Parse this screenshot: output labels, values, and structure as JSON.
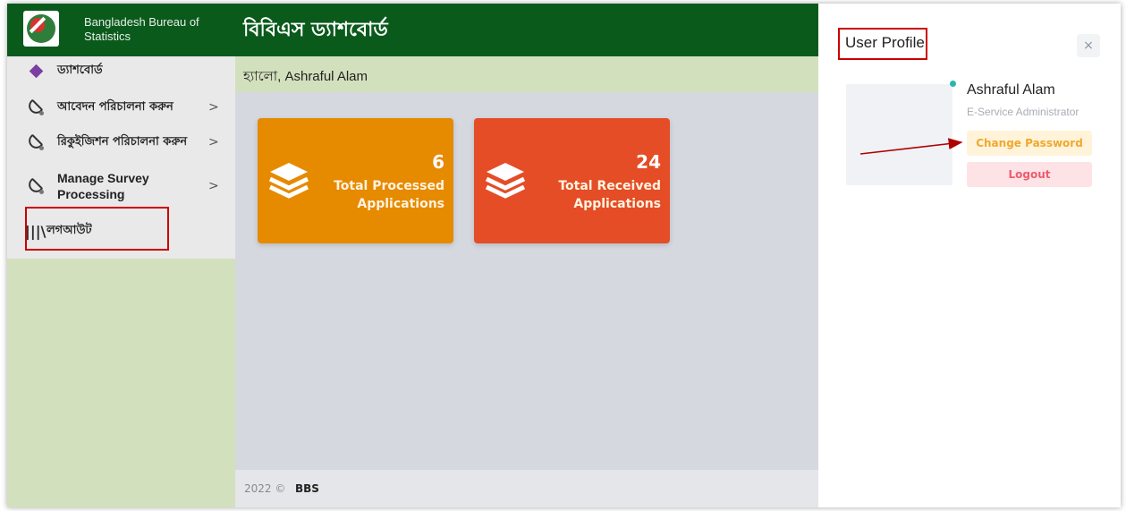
{
  "header": {
    "org_name": "Bangladesh Bureau of Statistics",
    "app_title": "বিবিএস ড্যাশবোর্ড"
  },
  "greeting": "হ্যালো, Ashraful Alam",
  "sidebar": {
    "items": [
      {
        "label": "ড্যাশবোর্ড",
        "icon": "diamond-icon"
      },
      {
        "label": "আবেদন পরিচালনা করুন",
        "icon": "drop-icon",
        "chevron": ">"
      },
      {
        "label": "রিকুইজিশন পরিচালনা করুন",
        "icon": "drop-icon",
        "chevron": ">"
      },
      {
        "label": "Manage Survey Processing",
        "icon": "drop-icon",
        "chevron": ">"
      },
      {
        "label": "লগআউট",
        "icon": "books-icon"
      }
    ]
  },
  "cards": [
    {
      "value": "6",
      "title": "Total Processed Applications",
      "color": "#e68a00",
      "icon": "layers-icon"
    },
    {
      "value": "24",
      "title": "Total Received Applications",
      "color": "#e44d26",
      "icon": "layers-icon"
    }
  ],
  "footer": {
    "year": "2022 ©",
    "org": "BBS"
  },
  "profile": {
    "title": "User Profile",
    "close": "×",
    "name": "Ashraful Alam",
    "role": "E-Service Administrator",
    "change_password": "Change Password",
    "logout": "Logout"
  },
  "colors": {
    "header_green": "#0a5a1c",
    "sidebar_bg": "#d3e0bd",
    "annotation_red": "#cc0000"
  }
}
